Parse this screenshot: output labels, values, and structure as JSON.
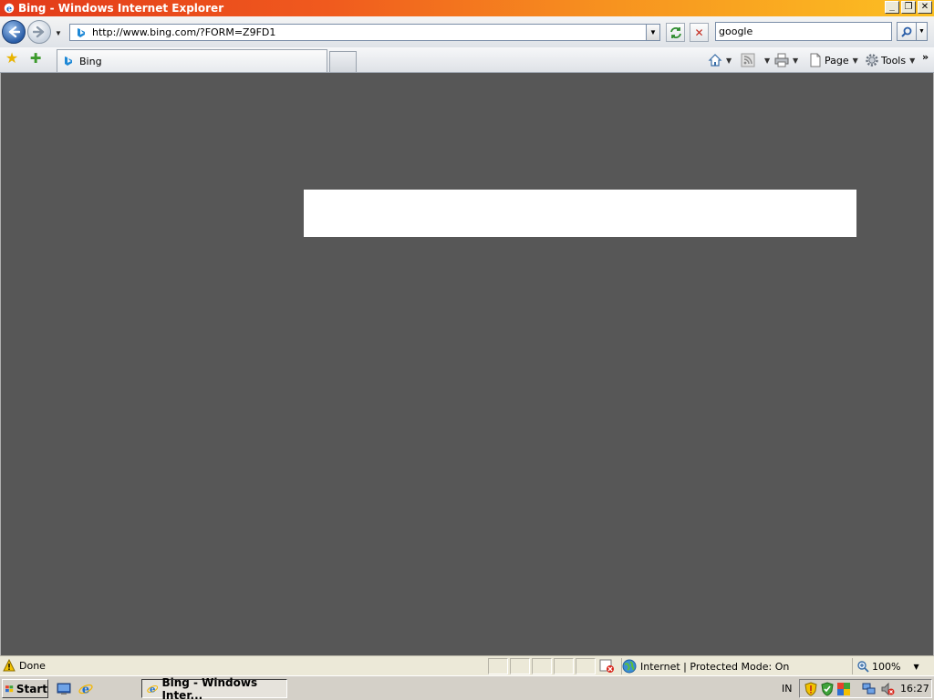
{
  "window": {
    "title": "Bing - Windows Internet Explorer",
    "minimize_label": "_",
    "restore_label": "❐",
    "close_label": "✕"
  },
  "navigation": {
    "address_url": "http://www.bing.com/?FORM=Z9FD1",
    "search_value": "google"
  },
  "tabs": [
    {
      "label": "Bing"
    }
  ],
  "command_bar": {
    "page_label": "Page",
    "tools_label": "Tools",
    "overflow_label": "»"
  },
  "status_bar": {
    "status_text": "Done",
    "zone_text": "Internet | Protected Mode: On",
    "zoom_text": "100%"
  },
  "taskbar": {
    "start_label": "Start",
    "task_label": "Bing - Windows Inter...",
    "language": "IN",
    "clock": "16:27"
  },
  "colors": {
    "content_background": "#575757",
    "titlebar_start": "#e23a1a",
    "titlebar_end": "#fcc022"
  }
}
